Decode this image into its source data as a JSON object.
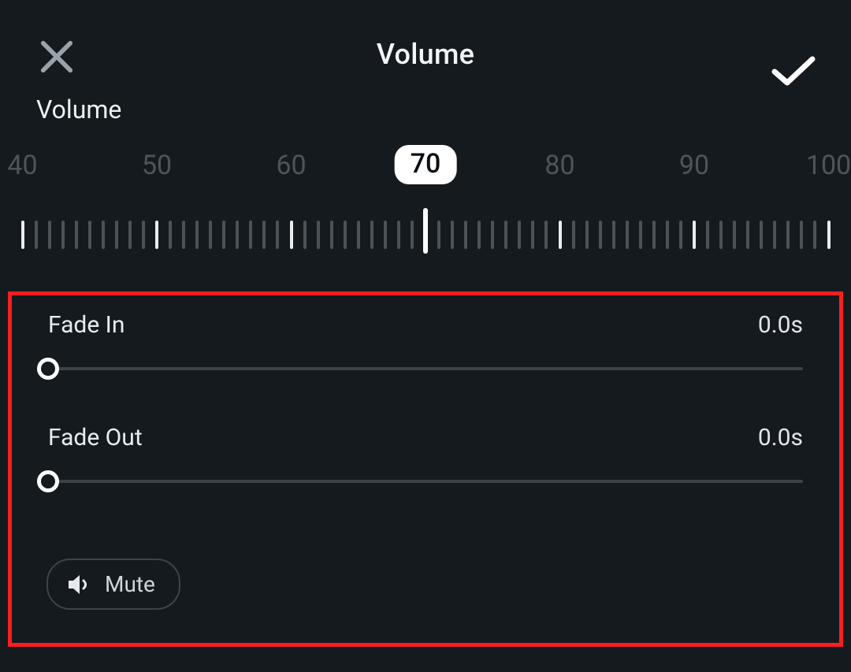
{
  "header": {
    "title": "Volume"
  },
  "section": {
    "label": "Volume"
  },
  "ruler": {
    "min_visible": 40,
    "max_visible": 100,
    "value": 70,
    "ticks": {
      "start": 40,
      "end": 100,
      "step": 1,
      "major_every": 10
    },
    "labels": [
      40,
      50,
      60,
      70,
      80,
      90,
      100
    ]
  },
  "fade_in": {
    "label": "Fade In",
    "value": "0.0s",
    "slider_percent": 0
  },
  "fade_out": {
    "label": "Fade Out",
    "value": "0.0s",
    "slider_percent": 0
  },
  "mute": {
    "label": "Mute"
  },
  "icons": {
    "close": "close-icon",
    "confirm": "check-icon",
    "speaker": "speaker-icon"
  },
  "colors": {
    "background": "#151a1e",
    "highlight_border": "#ff1e1e",
    "active_pill_bg": "#ffffff",
    "tick_minor": "#4b5359",
    "tick_major": "#e9edf0"
  }
}
